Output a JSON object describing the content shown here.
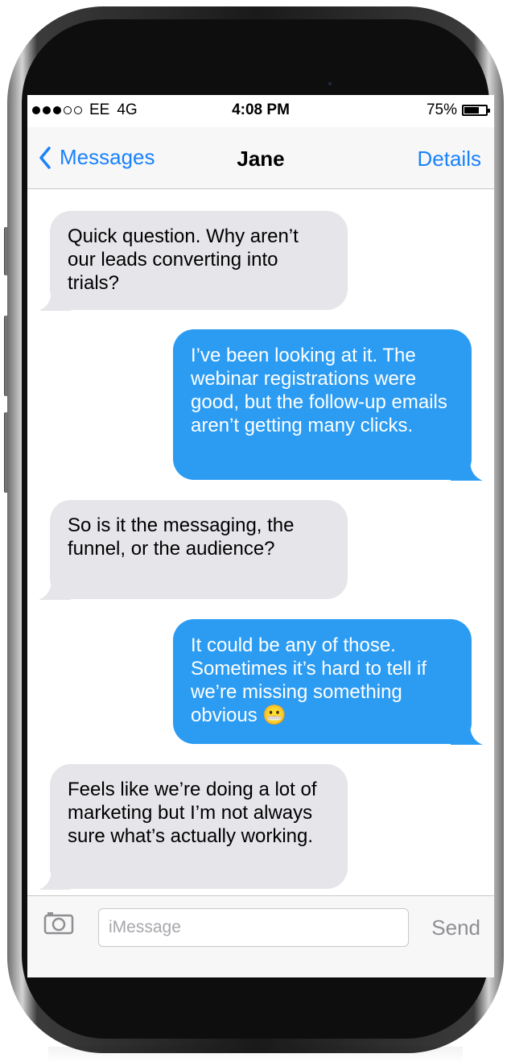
{
  "status_bar": {
    "signal_filled": 3,
    "signal_total": 5,
    "carrier": "EE",
    "network": "4G",
    "time": "4:08 PM",
    "battery_percent": "75%",
    "battery_level": 0.75
  },
  "nav": {
    "back_label": "Messages",
    "contact_name": "Jane",
    "details_label": "Details"
  },
  "messages": [
    {
      "direction": "incoming",
      "text": "Quick question. Why aren’t our leads converting into trials?"
    },
    {
      "direction": "outgoing",
      "text": "I’ve been looking at it. The webinar registrations were good, but the follow-up emails aren’t getting many clicks."
    },
    {
      "direction": "incoming",
      "text": "So is it the messaging, the funnel, or the audience?"
    },
    {
      "direction": "outgoing",
      "text": "It could be any of those. Sometimes it’s hard to tell if we’re missing something obvious 😬"
    },
    {
      "direction": "incoming",
      "text": "Feels like we’re doing a lot of marketing but I’m not always sure what’s actually working."
    }
  ],
  "composer": {
    "camera_icon": "camera-icon",
    "placeholder": "iMessage",
    "value": "",
    "send_label": "Send"
  },
  "colors": {
    "incoming_bubble": "#e5e5ea",
    "outgoing_bubble": "#2c9cf3",
    "ios_blue": "#1a82fb",
    "send_disabled": "#8e8e93"
  }
}
